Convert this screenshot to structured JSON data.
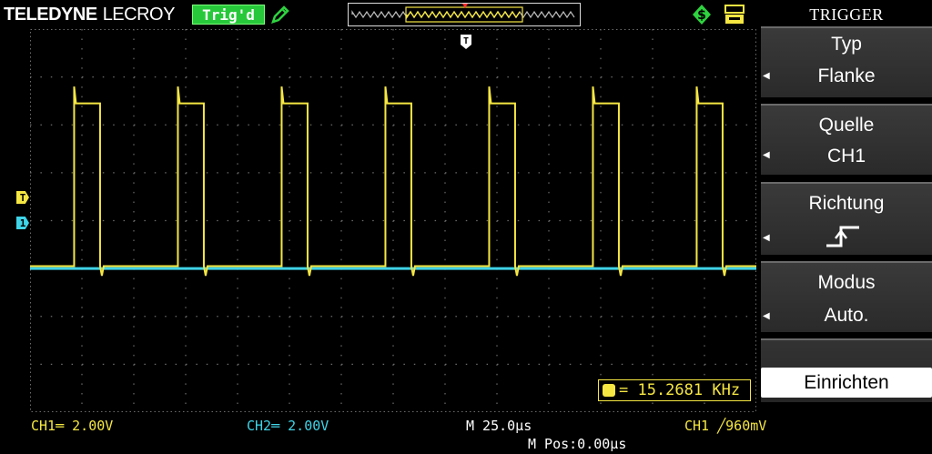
{
  "brand": {
    "name_bold": "TELEDYNE",
    "name_regular": "LECROY"
  },
  "status": {
    "label": "Trig'd"
  },
  "menu": {
    "title": "TRIGGER",
    "items": [
      {
        "label": "Typ",
        "value": "Flanke"
      },
      {
        "label": "Quelle",
        "value": "CH1"
      },
      {
        "label": "Richtung",
        "value_icon": "rising-edge-icon"
      },
      {
        "label": "Modus",
        "value": "Auto."
      }
    ],
    "action": {
      "label": "Einrichten"
    }
  },
  "measurements": {
    "frequency": "= 15.2681 KHz"
  },
  "footer": {
    "ch1": "CH1═ 2.00V",
    "ch2": "CH2═ 2.00V",
    "timebase": "M 25.0μs",
    "position": "M Pos:0.00μs",
    "trigger": "CH1 ╱960mV"
  },
  "markers": {
    "trigger_time": "T",
    "trigger_level": "T",
    "ch1": "1"
  },
  "colors": {
    "ch1": "#f5e642",
    "ch2": "#3fd4e8",
    "grid": "#6b6b6b",
    "status": "#27c93a",
    "icon_green": "#2ed33f"
  },
  "chart_data": {
    "type": "line",
    "x_divisions": 14,
    "y_divisions": 8,
    "series": [
      {
        "channel": "ch1",
        "shape": "pulse-train",
        "period_div": 2.0,
        "first_rise_div": 0.85,
        "high_width_div": 0.5,
        "low_level_div": 4.95,
        "high_level_div": 1.55,
        "overshoot_div": 0.35,
        "undershoot_div": 0.2
      },
      {
        "channel": "ch2",
        "shape": "flat",
        "level_div": 5.0
      }
    ]
  }
}
